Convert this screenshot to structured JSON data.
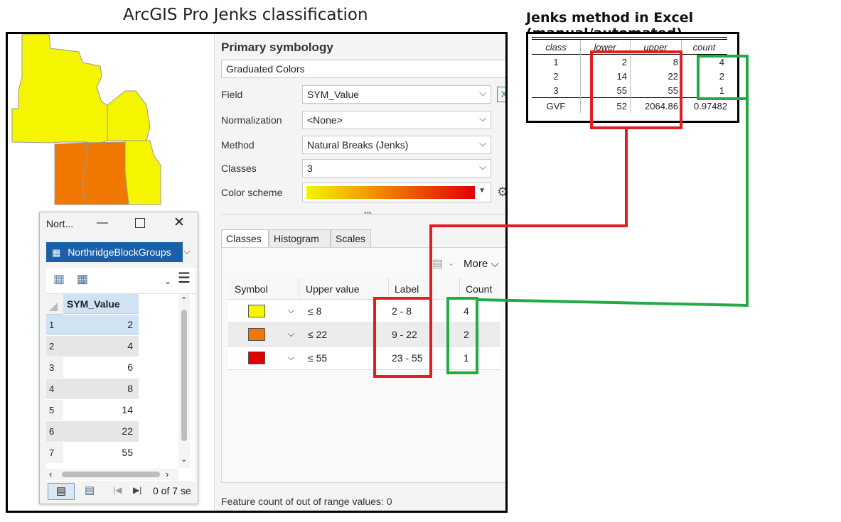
{
  "titles": {
    "left": "ArcGIS Pro Jenks classification",
    "right": "Jenks method in Excel (manual/automated)"
  },
  "colors": {
    "class1": "#f5f500",
    "class2": "#f07800",
    "class3": "#e00000",
    "highlight_red": "#e02020",
    "highlight_green": "#22aa44",
    "accent_blue": "#1a5fa8"
  },
  "symbology": {
    "heading": "Primary symbology",
    "renderer": "Graduated Colors",
    "field_label": "Field",
    "field_value": "SYM_Value",
    "normalization_label": "Normalization",
    "normalization_value": "<None>",
    "method_label": "Method",
    "method_value": "Natural Breaks (Jenks)",
    "classes_label": "Classes",
    "classes_value": "3",
    "color_scheme_label": "Color scheme",
    "tabs": [
      "Classes",
      "Histogram",
      "Scales"
    ],
    "more_label": "More",
    "columns": [
      "Symbol",
      "Upper value",
      "Label",
      "Count"
    ],
    "rows": [
      {
        "upper": "≤  8",
        "label": "2 - 8",
        "count": "4"
      },
      {
        "upper": "≤  22",
        "label": "9 - 22",
        "count": "2"
      },
      {
        "upper": "≤  55",
        "label": "23 - 55",
        "count": "1"
      }
    ],
    "footer": "Feature count of out of range values: 0"
  },
  "attribute_table": {
    "window_title": "Nort...",
    "layer_tab": "NorthridgeBlockGroups",
    "column": "SYM_Value",
    "rows": [
      {
        "n": "1",
        "v": "2"
      },
      {
        "n": "2",
        "v": "4"
      },
      {
        "n": "3",
        "v": "6"
      },
      {
        "n": "4",
        "v": "8"
      },
      {
        "n": "5",
        "v": "14"
      },
      {
        "n": "6",
        "v": "22"
      },
      {
        "n": "7",
        "v": "55"
      }
    ],
    "status": "0 of 7 se"
  },
  "excel": {
    "headers": [
      "class",
      "lower",
      "upper",
      "count"
    ],
    "rows": [
      [
        "1",
        "2",
        "8",
        "4"
      ],
      [
        "2",
        "14",
        "22",
        "2"
      ],
      [
        "3",
        "55",
        "55",
        "1"
      ]
    ],
    "gvf_row": [
      "GVF",
      "52",
      "2064.86",
      "0.97482"
    ]
  }
}
